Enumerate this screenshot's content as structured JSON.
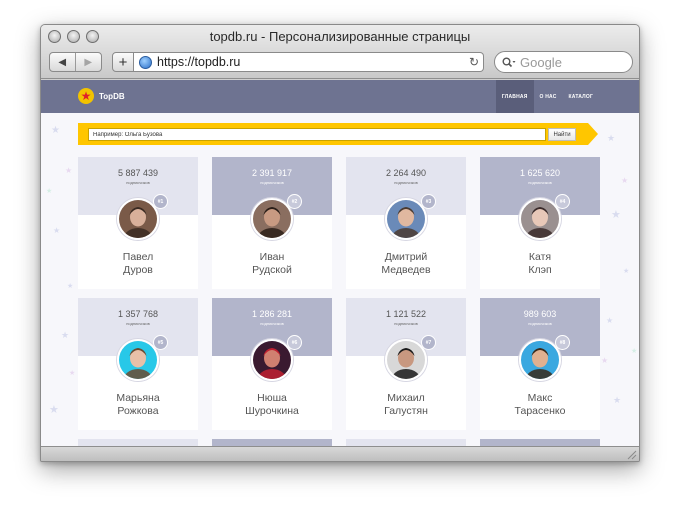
{
  "window": {
    "title": "topdb.ru - Персонализированные страницы"
  },
  "browser": {
    "back_icon": "back-arrow-icon",
    "forward_icon": "forward-arrow-icon",
    "url": "https://topdb.ru",
    "search_placeholder": "Google"
  },
  "site": {
    "logo": "TopDB",
    "nav": [
      {
        "label": "ГЛАВНАЯ",
        "active": true
      },
      {
        "label": "О НАС",
        "active": false
      },
      {
        "label": "КАТАЛОГ",
        "active": false
      }
    ],
    "search": {
      "placeholder": "Например: Ольга Бузова",
      "button": "Найти"
    },
    "colors": {
      "nav": "#6e7391",
      "ribbon": "#ffc600",
      "card_dark": "#b2b5cb",
      "card_light": "#e3e4ef"
    }
  },
  "cards": [
    {
      "count": "5 887 439",
      "sub": "подписчиков",
      "rank": "#1",
      "first": "Павел",
      "last": "Дуров"
    },
    {
      "count": "2 391 917",
      "sub": "подписчиков",
      "rank": "#2",
      "first": "Иван",
      "last": "Рудской"
    },
    {
      "count": "2 264 490",
      "sub": "подписчиков",
      "rank": "#3",
      "first": "Дмитрий",
      "last": "Медведев"
    },
    {
      "count": "1 625 620",
      "sub": "подписчиков",
      "rank": "#4",
      "first": "Катя",
      "last": "Клэп"
    },
    {
      "count": "1 357 768",
      "sub": "подписчиков",
      "rank": "#5",
      "first": "Марьяна",
      "last": "Рожкова"
    },
    {
      "count": "1 286 281",
      "sub": "подписчиков",
      "rank": "#6",
      "first": "Нюша",
      "last": "Шурочкина"
    },
    {
      "count": "1 121 522",
      "sub": "подписчиков",
      "rank": "#7",
      "first": "Михаил",
      "last": "Галустян"
    },
    {
      "count": "989 603",
      "sub": "подписчиков",
      "rank": "#8",
      "first": "Макс",
      "last": "Тарасенко"
    }
  ]
}
